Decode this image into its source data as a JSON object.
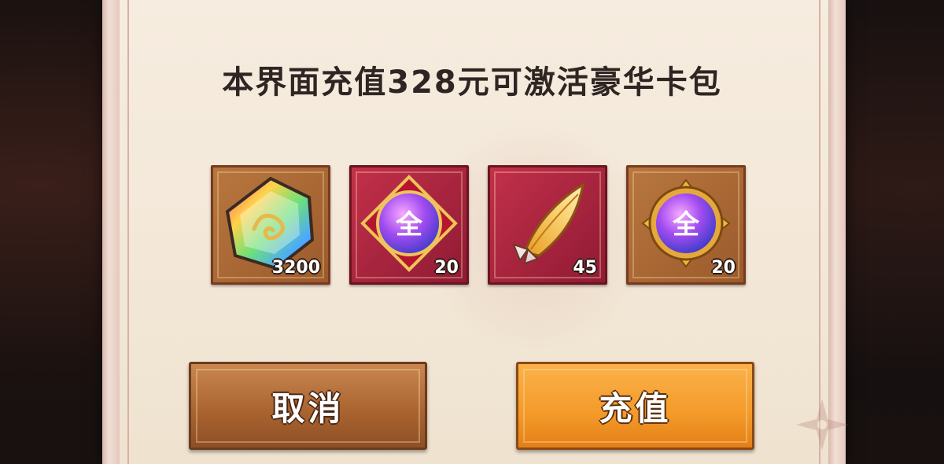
{
  "dialog": {
    "title": "本界面充值328元可激活豪华卡包"
  },
  "rewards": [
    {
      "icon": "rainbow-crystal-icon",
      "count": "3200",
      "frame": "brown"
    },
    {
      "icon": "purple-orb-red-frame-icon",
      "count": "20",
      "frame": "red"
    },
    {
      "icon": "golden-feather-icon",
      "count": "45",
      "frame": "red"
    },
    {
      "icon": "purple-orb-gold-frame-icon",
      "count": "20",
      "frame": "brown"
    }
  ],
  "orb_label": "全",
  "buttons": {
    "cancel_label": "取消",
    "confirm_label": "充值"
  },
  "colors": {
    "panel": "#f3e8d8",
    "title": "#2f2624",
    "cancel": "#a8622f",
    "confirm": "#f39a2a"
  }
}
